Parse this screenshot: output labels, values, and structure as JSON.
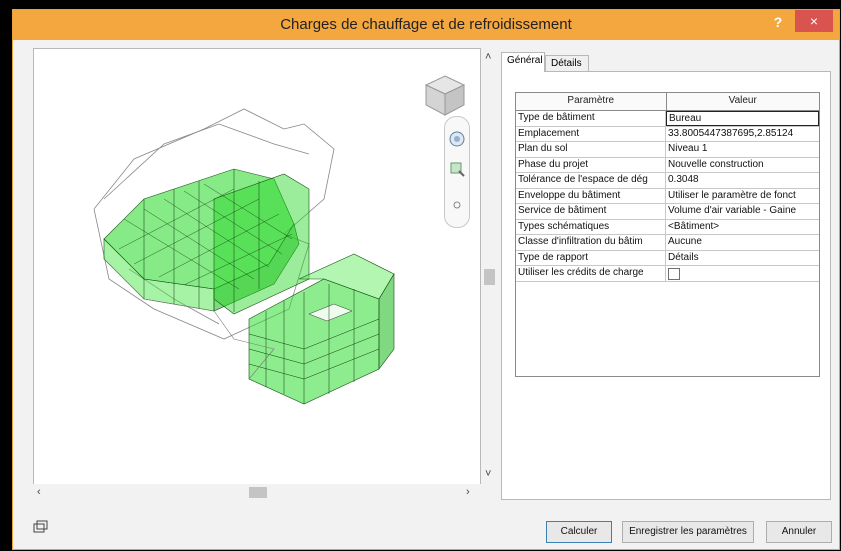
{
  "window": {
    "title": "Charges de chauffage et de refroidissement",
    "help_label": "?",
    "close_label": "×"
  },
  "tabs": [
    {
      "label": "Général",
      "active": true
    },
    {
      "label": "Détails",
      "active": false
    }
  ],
  "grid": {
    "headers": {
      "param": "Paramètre",
      "value": "Valeur"
    },
    "rows": [
      {
        "param": "Type de bâtiment",
        "value": "Bureau"
      },
      {
        "param": "Emplacement",
        "value": "33.8005447387695,2.85124"
      },
      {
        "param": "Plan du sol",
        "value": "Niveau 1"
      },
      {
        "param": "Phase du projet",
        "value": "Nouvelle construction"
      },
      {
        "param": "Tolérance de l'espace de dég",
        "value": "0.3048"
      },
      {
        "param": "Enveloppe du bâtiment",
        "value": "Utiliser le paramètre de fonct"
      },
      {
        "param": "Service de bâtiment",
        "value": "Volume d'air variable - Gaine"
      },
      {
        "param": "Types schématiques",
        "value": "<Bâtiment>"
      },
      {
        "param": "Classe d'infiltration du bâtim",
        "value": "Aucune"
      },
      {
        "param": "Type de rapport",
        "value": "Détails"
      },
      {
        "param": "Utiliser les crédits de charge",
        "value": ""
      }
    ]
  },
  "buttons": {
    "calculate": "Calculer",
    "save_settings": "Enregistrer les paramètres",
    "cancel": "Annuler"
  },
  "icons": {
    "viewcube": "viewcube-icon",
    "steering_wheel": "steering-wheel-icon",
    "zoom": "zoom-icon",
    "display_mode": "display-mode-icon"
  },
  "colors": {
    "title_bar": "#f4a63f",
    "close_button": "#d9534f",
    "model_fill": "#22d822"
  }
}
